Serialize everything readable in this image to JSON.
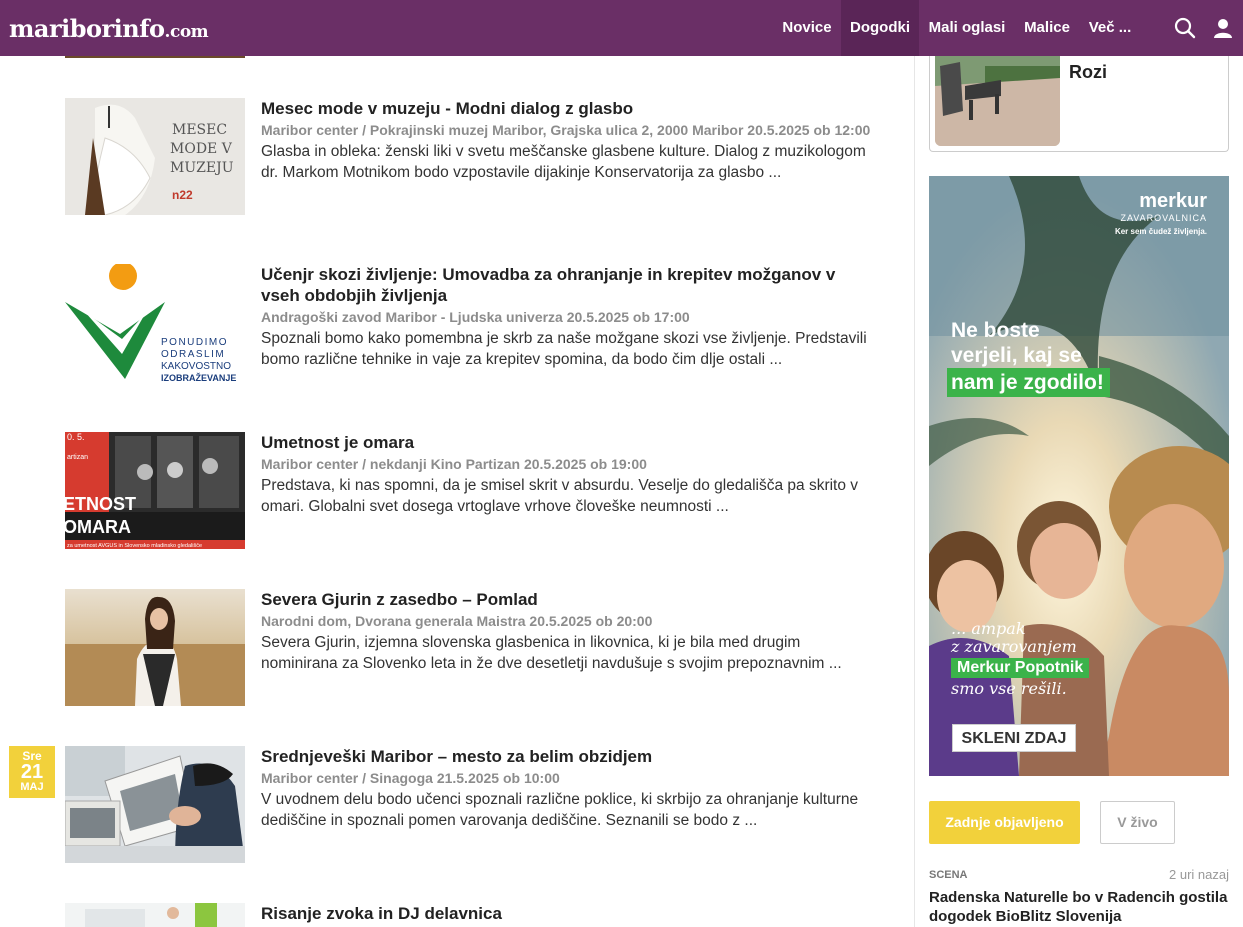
{
  "header": {
    "logo_main": "mariborinfo",
    "logo_domain": ".com",
    "nav": [
      "Novice",
      "Dogodki",
      "Mali oglasi",
      "Malice",
      "Več ..."
    ],
    "active_nav": "Dogodki",
    "icons": [
      "search-icon",
      "user-icon"
    ],
    "colors": {
      "bar": "#6a2f66",
      "active": "#5a2557"
    }
  },
  "events": [
    {
      "title": "Mesec mode v muzeju - Modni dialog z glasbo",
      "meta": "Maribor center / Pokrajinski muzej Maribor, Grajska ulica 2, 2000 Maribor 20.5.2025 ob 12:00",
      "desc": "Glasba in obleka: ženski liki v svetu meščanske glasbene kulture. Dialog z muzikologom dr. Markom Motnikom bodo vzpostavile dijakinje Konservatorija za glasbo ...",
      "thumb_text": [
        "MESEC",
        "MODE V",
        "MUZEJU",
        "n22"
      ]
    },
    {
      "title": "Učenjr skozi življenje: Umovadba za ohranjanje in krepitev možganov v vseh obdobjih življenja",
      "meta": "Andragoški zavod Maribor - Ljudska univerza 20.5.2025 ob 17:00",
      "desc": "Spoznali bomo kako pomembna je skrb za naše možgane skozi vse življenje. Predstavili bomo različne tehnike in vaje za krepitev spomina, da bodo čim dlje ostali ...",
      "thumb_text": [
        "PONUDIMO",
        "ODRASLIM",
        "KAKOVOSTNO",
        "IZOBRAŽEVANJE"
      ]
    },
    {
      "title": "Umetnost je omara",
      "meta": "Maribor center / nekdanji Kino Partizan 20.5.2025 ob 19:00",
      "desc": "Predstava, ki nas spomni, da je smisel skrit v absurdu. Veselje do gledališča pa skrito v omari. Globalni svet dosega vrtoglave vrhove človeške neumnosti ...",
      "thumb_text": [
        "0. 5.",
        "artizan",
        "ETNOST",
        "OMARA",
        "za umetnost AVGUS in Slovensko mladinsko gledališče"
      ]
    },
    {
      "title": "Severa Gjurin z zasedbo – Pomlad",
      "meta": "Narodni dom, Dvorana generala Maistra 20.5.2025 ob 20:00",
      "desc": "Severa Gjurin, izjemna slovenska glasbenica in likovnica, ki je bila med drugim nominirana za Slovenko leta in že dve desetletji navdušuje s svojim prepoznavnim ...",
      "thumb_text": []
    },
    {
      "title": "Srednjeveški Maribor – mesto za belim obzidjem",
      "meta": "Maribor center / Sinagoga 21.5.2025 ob 10:00",
      "desc": "V uvodnem delu bodo učenci spoznali različne poklice, ki skrbijo za ohranjanje kulturne dediščine in spoznali pomen varovanja dediščine. Seznanili se bodo z ...",
      "thumb_text": []
    },
    {
      "title": "Risanje zvoka in DJ delavnica",
      "meta": "",
      "desc": "",
      "thumb_text": []
    }
  ],
  "date_badge": {
    "day": "Sre",
    "num": "21",
    "month": "MAJ",
    "color": "#f2d13b"
  },
  "sidebar": {
    "card_title": "Rozi",
    "ad": {
      "brand": "merkur",
      "brand_sub": "ZAVAROVALNICA",
      "brand_slogan": "Ker sem čudež življenja.",
      "headline_1": "Ne boste",
      "headline_2": "verjeli, kaj se",
      "headline_3": "nam je zgodilo!",
      "tag_1": "... ampak",
      "tag_2": "z zavarovanjem",
      "tag_3": "Merkur Popotnik",
      "tag_4": "smo vse rešili.",
      "cta": "SKLENI ZDAJ",
      "accent": "#3bb34a"
    },
    "tabs": {
      "latest": "Zadnje objavljeno",
      "live": "V živo"
    },
    "news": {
      "category": "SCENA",
      "time": "2 uri nazaj",
      "title": "Radenska Naturelle bo v Radencih gostila dogodek BioBlitz Slovenija"
    }
  }
}
